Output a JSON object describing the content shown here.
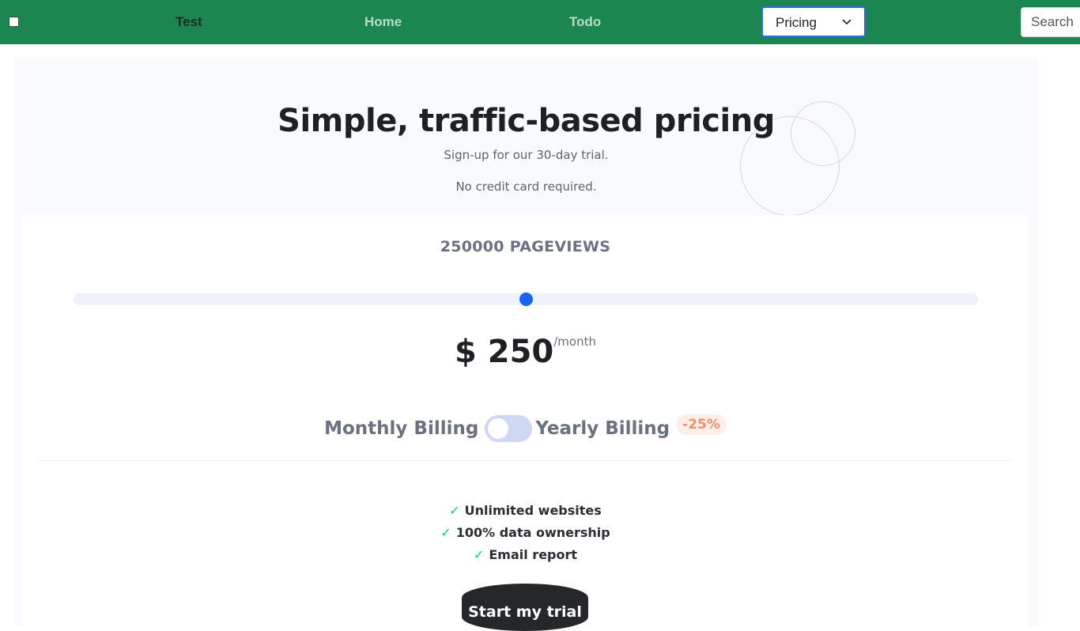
{
  "navbar": {
    "brand": "Test",
    "links": [
      "Home",
      "Todo"
    ],
    "select_value": "Pricing",
    "search_placeholder": "Search",
    "background_color": "#1c8651"
  },
  "hero": {
    "title": "Simple, traffic-based pricing",
    "subtitle_1": "Sign-up for our 30-day trial.",
    "subtitle_2": "No credit card required."
  },
  "pricing": {
    "pageviews_label": "250000 PAGEVIEWS",
    "slider_fraction": 0.5,
    "price": "$ 250",
    "period": "/month",
    "billing_monthly": "Monthly Billing",
    "billing_yearly": "Yearly Billing",
    "yearly_toggle_on": false,
    "discount": "-25%",
    "accent_color": "#1565f0"
  },
  "features": [
    "Unlimited websites",
    "100% data ownership",
    "Email report"
  ],
  "icons": {
    "check": "✓",
    "chevron": "chevron-down-icon"
  },
  "cta": {
    "label": "Start my trial"
  }
}
